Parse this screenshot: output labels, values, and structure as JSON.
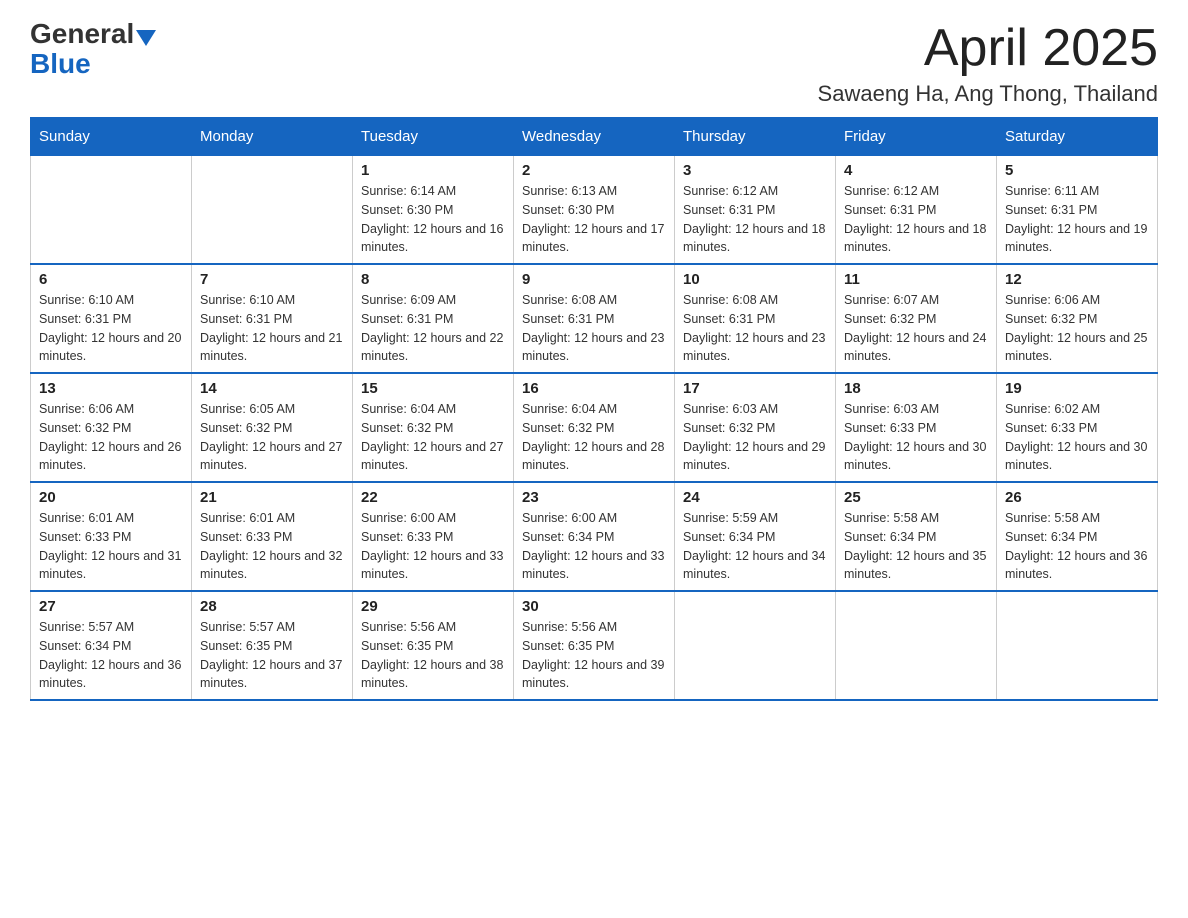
{
  "header": {
    "logo_general": "General",
    "logo_blue": "Blue",
    "title": "April 2025",
    "subtitle": "Sawaeng Ha, Ang Thong, Thailand"
  },
  "calendar": {
    "days_of_week": [
      "Sunday",
      "Monday",
      "Tuesday",
      "Wednesday",
      "Thursday",
      "Friday",
      "Saturday"
    ],
    "weeks": [
      [
        {
          "day": "",
          "sunrise": "",
          "sunset": "",
          "daylight": ""
        },
        {
          "day": "",
          "sunrise": "",
          "sunset": "",
          "daylight": ""
        },
        {
          "day": "1",
          "sunrise": "Sunrise: 6:14 AM",
          "sunset": "Sunset: 6:30 PM",
          "daylight": "Daylight: 12 hours and 16 minutes."
        },
        {
          "day": "2",
          "sunrise": "Sunrise: 6:13 AM",
          "sunset": "Sunset: 6:30 PM",
          "daylight": "Daylight: 12 hours and 17 minutes."
        },
        {
          "day": "3",
          "sunrise": "Sunrise: 6:12 AM",
          "sunset": "Sunset: 6:31 PM",
          "daylight": "Daylight: 12 hours and 18 minutes."
        },
        {
          "day": "4",
          "sunrise": "Sunrise: 6:12 AM",
          "sunset": "Sunset: 6:31 PM",
          "daylight": "Daylight: 12 hours and 18 minutes."
        },
        {
          "day": "5",
          "sunrise": "Sunrise: 6:11 AM",
          "sunset": "Sunset: 6:31 PM",
          "daylight": "Daylight: 12 hours and 19 minutes."
        }
      ],
      [
        {
          "day": "6",
          "sunrise": "Sunrise: 6:10 AM",
          "sunset": "Sunset: 6:31 PM",
          "daylight": "Daylight: 12 hours and 20 minutes."
        },
        {
          "day": "7",
          "sunrise": "Sunrise: 6:10 AM",
          "sunset": "Sunset: 6:31 PM",
          "daylight": "Daylight: 12 hours and 21 minutes."
        },
        {
          "day": "8",
          "sunrise": "Sunrise: 6:09 AM",
          "sunset": "Sunset: 6:31 PM",
          "daylight": "Daylight: 12 hours and 22 minutes."
        },
        {
          "day": "9",
          "sunrise": "Sunrise: 6:08 AM",
          "sunset": "Sunset: 6:31 PM",
          "daylight": "Daylight: 12 hours and 23 minutes."
        },
        {
          "day": "10",
          "sunrise": "Sunrise: 6:08 AM",
          "sunset": "Sunset: 6:31 PM",
          "daylight": "Daylight: 12 hours and 23 minutes."
        },
        {
          "day": "11",
          "sunrise": "Sunrise: 6:07 AM",
          "sunset": "Sunset: 6:32 PM",
          "daylight": "Daylight: 12 hours and 24 minutes."
        },
        {
          "day": "12",
          "sunrise": "Sunrise: 6:06 AM",
          "sunset": "Sunset: 6:32 PM",
          "daylight": "Daylight: 12 hours and 25 minutes."
        }
      ],
      [
        {
          "day": "13",
          "sunrise": "Sunrise: 6:06 AM",
          "sunset": "Sunset: 6:32 PM",
          "daylight": "Daylight: 12 hours and 26 minutes."
        },
        {
          "day": "14",
          "sunrise": "Sunrise: 6:05 AM",
          "sunset": "Sunset: 6:32 PM",
          "daylight": "Daylight: 12 hours and 27 minutes."
        },
        {
          "day": "15",
          "sunrise": "Sunrise: 6:04 AM",
          "sunset": "Sunset: 6:32 PM",
          "daylight": "Daylight: 12 hours and 27 minutes."
        },
        {
          "day": "16",
          "sunrise": "Sunrise: 6:04 AM",
          "sunset": "Sunset: 6:32 PM",
          "daylight": "Daylight: 12 hours and 28 minutes."
        },
        {
          "day": "17",
          "sunrise": "Sunrise: 6:03 AM",
          "sunset": "Sunset: 6:32 PM",
          "daylight": "Daylight: 12 hours and 29 minutes."
        },
        {
          "day": "18",
          "sunrise": "Sunrise: 6:03 AM",
          "sunset": "Sunset: 6:33 PM",
          "daylight": "Daylight: 12 hours and 30 minutes."
        },
        {
          "day": "19",
          "sunrise": "Sunrise: 6:02 AM",
          "sunset": "Sunset: 6:33 PM",
          "daylight": "Daylight: 12 hours and 30 minutes."
        }
      ],
      [
        {
          "day": "20",
          "sunrise": "Sunrise: 6:01 AM",
          "sunset": "Sunset: 6:33 PM",
          "daylight": "Daylight: 12 hours and 31 minutes."
        },
        {
          "day": "21",
          "sunrise": "Sunrise: 6:01 AM",
          "sunset": "Sunset: 6:33 PM",
          "daylight": "Daylight: 12 hours and 32 minutes."
        },
        {
          "day": "22",
          "sunrise": "Sunrise: 6:00 AM",
          "sunset": "Sunset: 6:33 PM",
          "daylight": "Daylight: 12 hours and 33 minutes."
        },
        {
          "day": "23",
          "sunrise": "Sunrise: 6:00 AM",
          "sunset": "Sunset: 6:34 PM",
          "daylight": "Daylight: 12 hours and 33 minutes."
        },
        {
          "day": "24",
          "sunrise": "Sunrise: 5:59 AM",
          "sunset": "Sunset: 6:34 PM",
          "daylight": "Daylight: 12 hours and 34 minutes."
        },
        {
          "day": "25",
          "sunrise": "Sunrise: 5:58 AM",
          "sunset": "Sunset: 6:34 PM",
          "daylight": "Daylight: 12 hours and 35 minutes."
        },
        {
          "day": "26",
          "sunrise": "Sunrise: 5:58 AM",
          "sunset": "Sunset: 6:34 PM",
          "daylight": "Daylight: 12 hours and 36 minutes."
        }
      ],
      [
        {
          "day": "27",
          "sunrise": "Sunrise: 5:57 AM",
          "sunset": "Sunset: 6:34 PM",
          "daylight": "Daylight: 12 hours and 36 minutes."
        },
        {
          "day": "28",
          "sunrise": "Sunrise: 5:57 AM",
          "sunset": "Sunset: 6:35 PM",
          "daylight": "Daylight: 12 hours and 37 minutes."
        },
        {
          "day": "29",
          "sunrise": "Sunrise: 5:56 AM",
          "sunset": "Sunset: 6:35 PM",
          "daylight": "Daylight: 12 hours and 38 minutes."
        },
        {
          "day": "30",
          "sunrise": "Sunrise: 5:56 AM",
          "sunset": "Sunset: 6:35 PM",
          "daylight": "Daylight: 12 hours and 39 minutes."
        },
        {
          "day": "",
          "sunrise": "",
          "sunset": "",
          "daylight": ""
        },
        {
          "day": "",
          "sunrise": "",
          "sunset": "",
          "daylight": ""
        },
        {
          "day": "",
          "sunrise": "",
          "sunset": "",
          "daylight": ""
        }
      ]
    ]
  }
}
